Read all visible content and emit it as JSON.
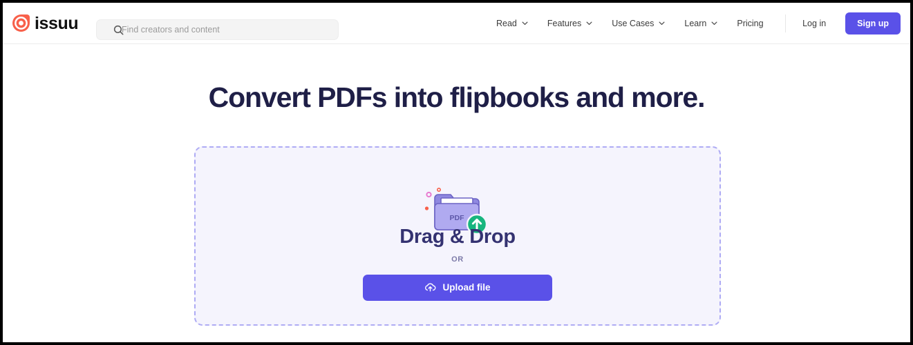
{
  "colors": {
    "brand_logo": "#f8604a",
    "accent_purple": "#5a51e8",
    "headline_navy": "#1f1f47",
    "dropzone_bg": "#f5f4fd",
    "dropzone_border": "#aeabf4",
    "folder_purple": "#b0aaf0",
    "badge_green": "#17b57e",
    "page_bg": "#ffffff"
  },
  "header": {
    "logo": {
      "icon": "issuu-target-icon",
      "wordmark": "issuu"
    },
    "search": {
      "icon": "search-icon",
      "value": "",
      "placeholder": "Find creators and content"
    },
    "nav": [
      {
        "label": "Read",
        "has_chevron": true,
        "icon": "chevron-down-icon"
      },
      {
        "label": "Features",
        "has_chevron": true,
        "icon": "chevron-down-icon"
      },
      {
        "label": "Use Cases",
        "has_chevron": true,
        "icon": "chevron-down-icon"
      },
      {
        "label": "Learn",
        "has_chevron": true,
        "icon": "chevron-down-icon"
      },
      {
        "label": "Pricing",
        "has_chevron": false,
        "icon": ""
      }
    ],
    "login_label": "Log in",
    "signup_label": "Sign up"
  },
  "main": {
    "headline": "Convert PDFs into flipbooks and more.",
    "dropzone": {
      "illustration": {
        "icon": "pdf-folder-upload-icon",
        "folder_label": "PDF",
        "badge_icon": "arrow-up-icon"
      },
      "title": "Drag & Drop",
      "divider_label": "OR",
      "upload_button": {
        "icon": "cloud-upload-icon",
        "label": "Upload file"
      }
    }
  }
}
